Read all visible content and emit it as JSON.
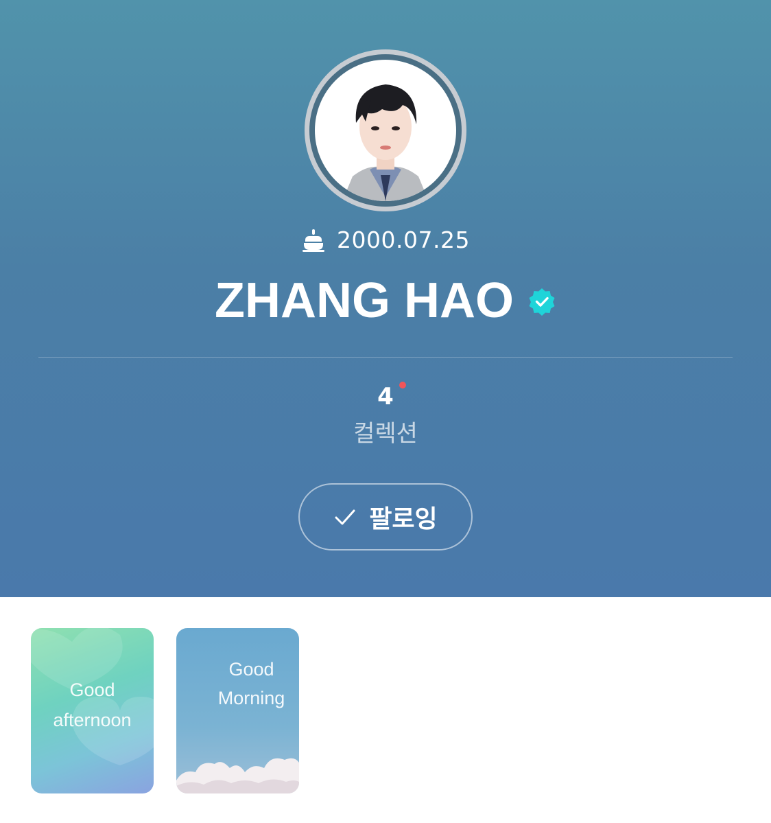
{
  "profile": {
    "birthday": "2000.07.25",
    "name": "ZHANG HAO",
    "verified": true,
    "collection_count": "4",
    "collection_label": "컬렉션",
    "has_new_badge": true,
    "follow_label": "팔로잉"
  },
  "icons": {
    "birthday": "cake-icon",
    "verified": "verified-badge-icon",
    "follow": "check-icon"
  },
  "colors": {
    "header_top": "#5193ab",
    "header_bottom": "#4a79ab",
    "verified": "#1fd4d9",
    "new_dot": "#f2555a"
  },
  "collections": [
    {
      "line1": "Good",
      "line2": "afternoon"
    },
    {
      "line1": "Good",
      "line2": "Morning"
    }
  ]
}
